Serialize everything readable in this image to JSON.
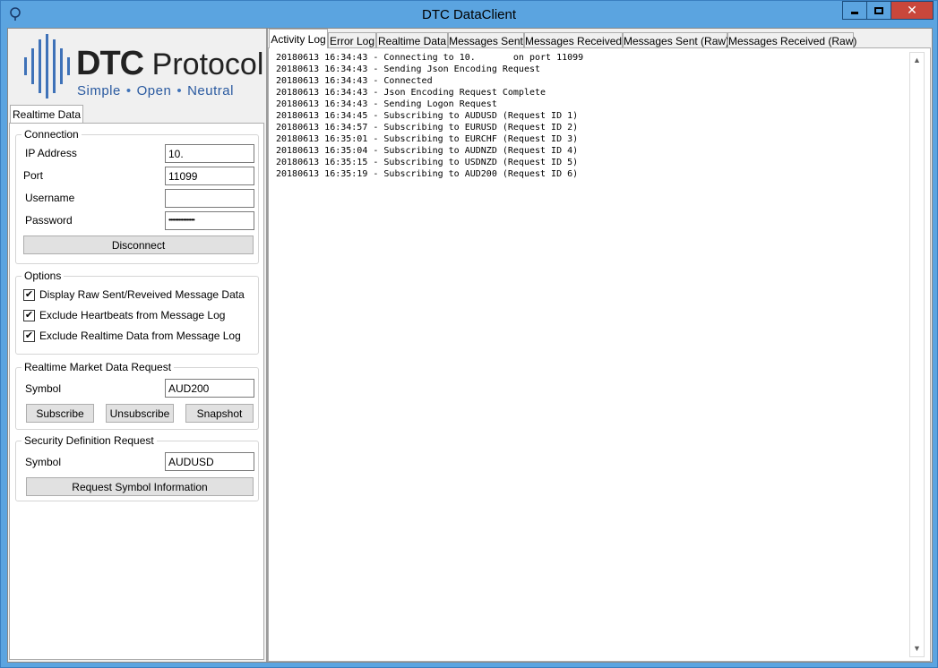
{
  "window": {
    "title": "DTC DataClient"
  },
  "logo": {
    "main": "DTC",
    "secondary": "Protocol",
    "tagline": [
      "Simple",
      "Open",
      "Neutral"
    ]
  },
  "left_tabs": [
    "Realtime Data"
  ],
  "connection": {
    "legend": "Connection",
    "ip_label": "IP Address",
    "ip_value": "10.",
    "port_label": "Port",
    "port_value": "11099",
    "username_label": "Username",
    "username_value": "",
    "password_label": "Password",
    "password_value": "••••••••••••••••",
    "disconnect_label": "Disconnect"
  },
  "options": {
    "legend": "Options",
    "items": [
      {
        "label": "Display Raw Sent/Reveived Message Data",
        "checked": true
      },
      {
        "label": "Exclude Heartbeats from Message Log",
        "checked": true
      },
      {
        "label": "Exclude Realtime Data from Message Log",
        "checked": true
      }
    ]
  },
  "market_data": {
    "legend": "Realtime Market Data Request",
    "symbol_label": "Symbol",
    "symbol_value": "AUD200",
    "subscribe_label": "Subscribe",
    "unsubscribe_label": "Unsubscribe",
    "snapshot_label": "Snapshot"
  },
  "security_def": {
    "legend": "Security Definition Request",
    "symbol_label": "Symbol",
    "symbol_value": "AUDUSD",
    "request_label": "Request Symbol Information"
  },
  "right_tabs": [
    "Activity Log",
    "Error Log",
    "Realtime Data",
    "Messages Sent",
    "Messages Received",
    "Messages Sent (Raw)",
    "Messages Received (Raw)"
  ],
  "activity_log": [
    "20180613 16:34:43 - Connecting to 10.       on port 11099",
    "20180613 16:34:43 - Sending Json Encoding Request",
    "20180613 16:34:43 - Connected",
    "20180613 16:34:43 - Json Encoding Request Complete",
    "20180613 16:34:43 - Sending Logon Request",
    "20180613 16:34:45 - Subscribing to AUDUSD (Request ID 1)",
    "20180613 16:34:57 - Subscribing to EURUSD (Request ID 2)",
    "20180613 16:35:01 - Subscribing to EURCHF (Request ID 3)",
    "20180613 16:35:04 - Subscribing to AUDNZD (Request ID 4)",
    "20180613 16:35:15 - Subscribing to USDNZD (Request ID 5)",
    "20180613 16:35:19 - Subscribing to AUD200 (Request ID 6)"
  ]
}
